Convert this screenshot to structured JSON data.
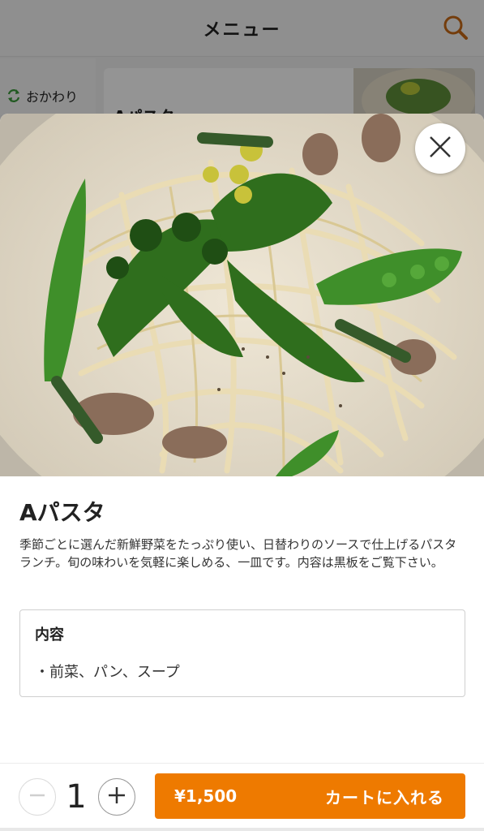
{
  "header": {
    "title": "メニュー",
    "search_icon": "search-icon"
  },
  "sidebar": {
    "items": [
      {
        "label": "おかわり",
        "icon": "refresh-icon"
      }
    ]
  },
  "background_card": {
    "title": "Aパスタ"
  },
  "modal": {
    "close_icon": "close-icon",
    "photo_alt": "pasta-photo",
    "title": "Aパスタ",
    "description": "季節ごとに選んだ新鮮野菜をたっぷり使い、日替わりのソースで仕上げるパスタランチ。旬の味わいを気軽に楽しめる、一皿です。内容は黒板をご覧下さい。",
    "contents": {
      "heading": "内容",
      "item": "・前菜、パン、スープ"
    }
  },
  "bottom_bar": {
    "quantity": "1",
    "price": "¥1,500",
    "cart_label": "カートに入れる"
  },
  "colors": {
    "accent": "#ee7a00",
    "header_icon": "#c96a16"
  }
}
